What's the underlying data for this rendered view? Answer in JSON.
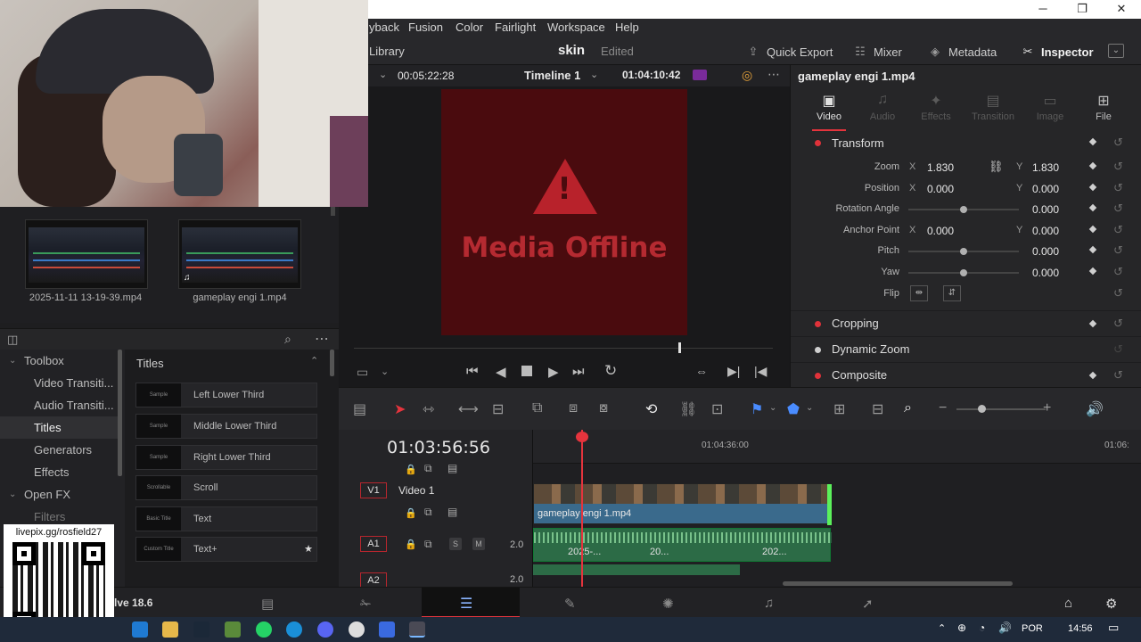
{
  "window": {
    "minimize": "─",
    "restore": "❐",
    "close": "✕"
  },
  "menu": {
    "items": [
      "yback",
      "Fusion",
      "Color",
      "Fairlight",
      "Workspace",
      "Help"
    ]
  },
  "project": {
    "library": "Library",
    "name": "skin",
    "status": "Edited",
    "quick_export": "Quick Export",
    "mixer": "Mixer",
    "metadata": "Metadata",
    "inspector": "Inspector"
  },
  "viewer": {
    "source_timecode": "00:05:22:28",
    "timeline_name": "Timeline 1",
    "record_timecode": "01:04:10:42",
    "offline_text": "Media Offline"
  },
  "inspector": {
    "clip_name": "gameplay engi 1.mp4",
    "tabs": [
      "Video",
      "Audio",
      "Effects",
      "Transition",
      "Image",
      "File"
    ],
    "transform": {
      "title": "Transform",
      "zoom_label": "Zoom",
      "zoom_x": "1.830",
      "zoom_y": "1.830",
      "position_label": "Position",
      "position_x": "0.000",
      "position_y": "0.000",
      "rotation_label": "Rotation Angle",
      "rotation": "0.000",
      "anchor_label": "Anchor Point",
      "anchor_x": "0.000",
      "anchor_y": "0.000",
      "pitch_label": "Pitch",
      "pitch": "0.000",
      "yaw_label": "Yaw",
      "yaw": "0.000",
      "flip_label": "Flip",
      "axis_x": "X",
      "axis_y": "Y"
    },
    "sections": [
      "Cropping",
      "Dynamic Zoom",
      "Composite"
    ]
  },
  "media_pool": {
    "clips": [
      "2025-11-11 13-19-39.mp4",
      "gameplay engi 1.mp4"
    ]
  },
  "effects": {
    "toolbox": "Toolbox",
    "tree": [
      "Video Transiti...",
      "Audio Transiti...",
      "Titles",
      "Generators",
      "Effects"
    ],
    "open_fx": "Open FX",
    "filters": "Filters",
    "list_title": "Titles",
    "templates": [
      "Left Lower Third",
      "Middle Lower Third",
      "Right Lower Third",
      "Scroll",
      "Text",
      "Text+"
    ],
    "thumbs": [
      "Sample",
      "Sample",
      "Sample",
      "Scrollable",
      "Basic Title",
      "Custom Title"
    ]
  },
  "stream": {
    "url": "livepix.gg/rosfield27",
    "version": "lve 18.6"
  },
  "timeline": {
    "timecode": "01:03:56:56",
    "ruler_label": "01:04:36:00",
    "ruler_label_2": "01:06:",
    "v1_badge": "V1",
    "v1_name": "Video 1",
    "a1_badge": "A1",
    "a1_level": "2.0",
    "a2_badge": "A2",
    "a2_level": "2.0",
    "solo": "S",
    "mute": "M",
    "video_clip": "gameplay engi 1.mp4",
    "audio_labels": [
      "2025-...",
      "20...",
      "202..."
    ]
  },
  "taskbar": {
    "lang": "POR",
    "time": "14:56"
  }
}
